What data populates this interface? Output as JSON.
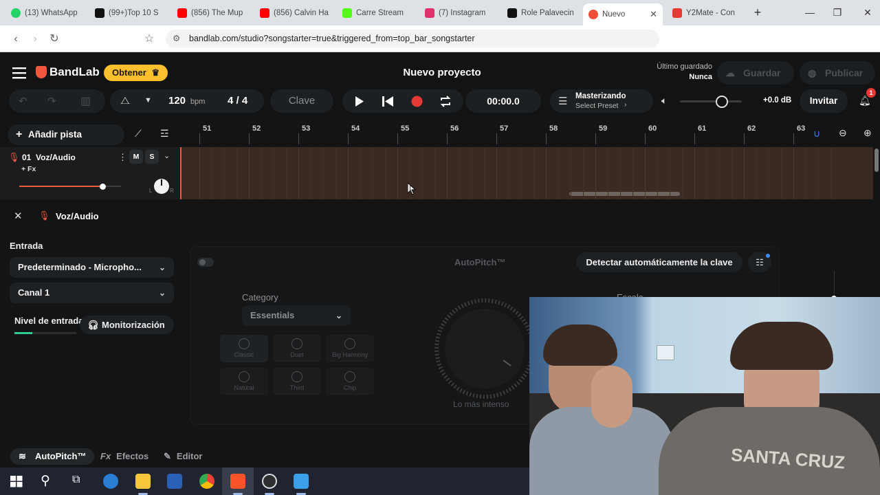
{
  "browser": {
    "tabs": [
      {
        "label": "(13) WhatsApp",
        "color": "#25d366"
      },
      {
        "label": "(99+)Top 10 S",
        "color": "#111111"
      },
      {
        "label": "(856) The Mup",
        "color": "#ff0000"
      },
      {
        "label": "(856) Calvin Ha",
        "color": "#ff0000"
      },
      {
        "label": "Carre Stream",
        "color": "#53fc18"
      },
      {
        "label": "(7) Instagram",
        "color": "#e1306c"
      },
      {
        "label": "Role Palavecin",
        "color": "#111111"
      },
      {
        "label": "Nuevo",
        "color": "#f04e38"
      },
      {
        "label": "Y2Mate - Con",
        "color": "#e53935"
      }
    ],
    "url": "bandlab.com/studio?songstarter=true&triggered_from=top_bar_songstarter"
  },
  "header": {
    "logo": "BandLab",
    "obtener": "Obtener",
    "project_title": "Nuevo proyecto",
    "last_saved_label": "Último guardado",
    "last_saved_value": "Nunca",
    "guardar": "Guardar",
    "publicar": "Publicar"
  },
  "transport": {
    "tempo": "120",
    "tempo_unit": "bpm",
    "time_sig": "4 / 4",
    "clave": "Clave",
    "time": "00:00.0",
    "mastering_title": "Masterizando",
    "mastering_preset": "Select Preset",
    "volume_db": "+0.0 dB",
    "invitar": "Invitar",
    "notif_count": "1"
  },
  "tracks": {
    "add_track": "Añadir pista",
    "ruler": [
      "51",
      "52",
      "53",
      "54",
      "55",
      "56",
      "57",
      "58",
      "59",
      "60",
      "61",
      "62",
      "63"
    ],
    "track1": {
      "name": "01  Voz/Audio",
      "fx": "+ Fx",
      "mute": "M",
      "solo": "S",
      "pan_l": "L",
      "pan_r": "R"
    }
  },
  "panel": {
    "title": "Voz/Audio",
    "input_label": "Entrada",
    "input_device": "Predeterminado - Micropho...",
    "channel": "Canal 1",
    "level_label": "Nivel de entrada",
    "monitor": "Monitorización",
    "autopitch_title": "AutoPitch™",
    "detect_key": "Detectar automáticamente la clave",
    "category_label": "Category",
    "category_value": "Essentials",
    "presets": [
      "Classic",
      "Duet",
      "Big Harmony",
      "Natural",
      "Third",
      "Chip"
    ],
    "intensity": "Lo más intenso",
    "scale": "Escala"
  },
  "bottom_tabs": {
    "autopitch": "AutoPitch™",
    "efectos": "Efectos",
    "editor": "Editor"
  },
  "webcam": {
    "shirt_text": "SANTA CRUZ"
  }
}
